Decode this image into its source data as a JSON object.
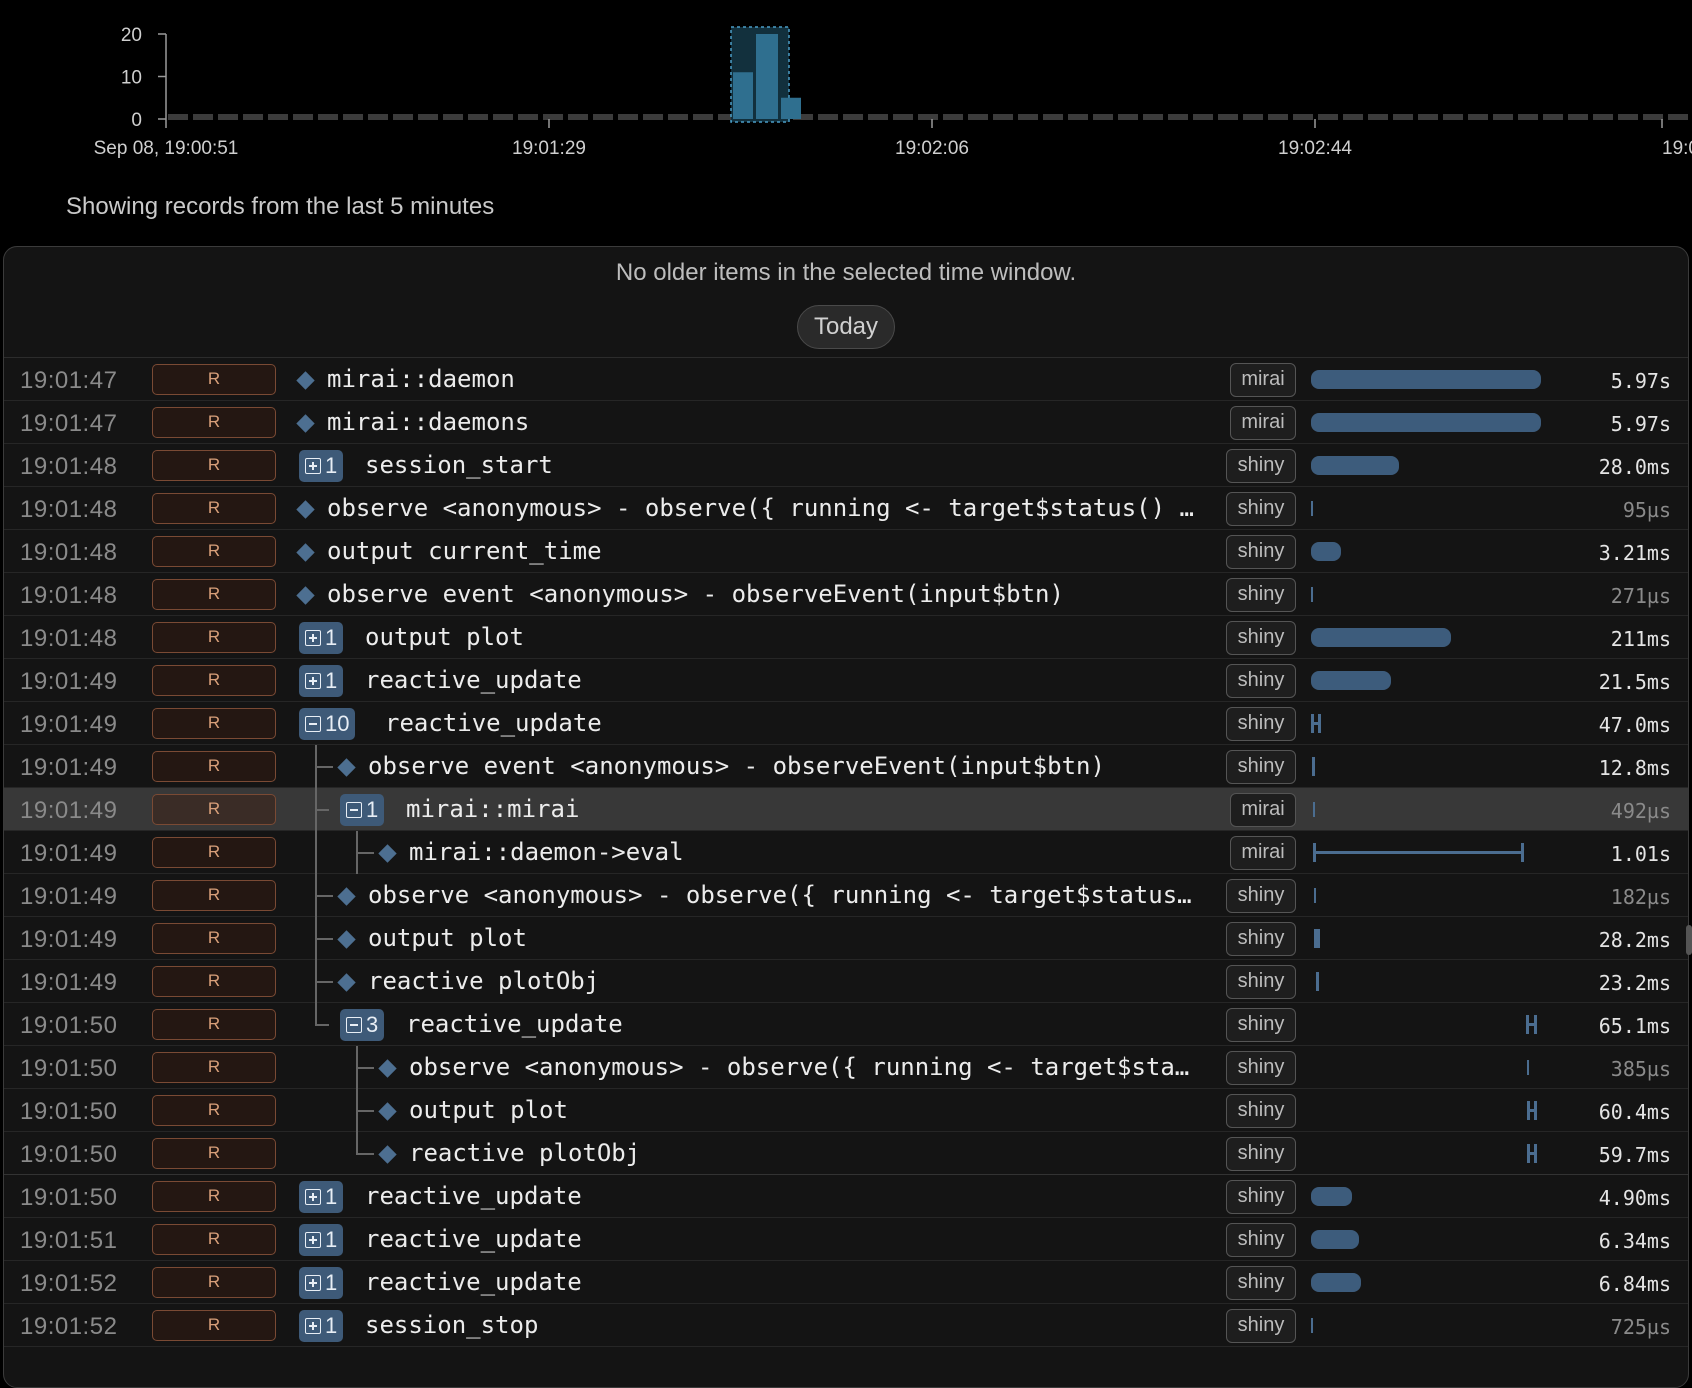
{
  "histogram": {
    "y_ticks": [
      "20",
      "10",
      "0"
    ],
    "x_ticks": [
      "Sep 08, 19:00:51",
      "19:01:29",
      "19:02:06",
      "19:02:44",
      "19:0"
    ],
    "colors": {
      "bar": "#2f6f8f",
      "selection": "#12303d",
      "baseline": "#3c3c3c"
    },
    "chart_data": {
      "type": "bar",
      "title": "",
      "xlabel": "",
      "ylabel": "",
      "ylim": [
        0,
        22
      ],
      "categories": [
        "19:01:47",
        "19:01:49",
        "19:01:51"
      ],
      "values": [
        11,
        20,
        5
      ]
    }
  },
  "status": {
    "showing_text": "Showing records from the last 5 minutes"
  },
  "header": {
    "no_older_text": "No older items in the selected time window.",
    "today_label": "Today"
  },
  "rows": [
    {
      "time": "19:01:47",
      "lang": "R",
      "kind": "leaf",
      "indent": 0,
      "name": "mirai::daemon",
      "lib": "mirai",
      "vis": "bar",
      "v_start": 0.0,
      "v_width": 0.92,
      "duration": "5.97s",
      "dim": false
    },
    {
      "time": "19:01:47",
      "lang": "R",
      "kind": "leaf",
      "indent": 0,
      "name": "mirai::daemons",
      "lib": "mirai",
      "vis": "bar",
      "v_start": 0.0,
      "v_width": 0.92,
      "duration": "5.97s",
      "dim": false
    },
    {
      "time": "19:01:48",
      "lang": "R",
      "kind": "group",
      "expanded": false,
      "count": "1",
      "indent": 0,
      "name": "session_start",
      "lib": "shiny",
      "vis": "bar",
      "v_start": 0.0,
      "v_width": 0.35,
      "duration": "28.0ms",
      "dim": false
    },
    {
      "time": "19:01:48",
      "lang": "R",
      "kind": "leaf",
      "indent": 0,
      "name": "observe <anonymous> - observe({ running <- target$status() …",
      "lib": "shiny",
      "vis": "tick",
      "v_start": 0.0,
      "duration": "95µs",
      "dim": true
    },
    {
      "time": "19:01:48",
      "lang": "R",
      "kind": "leaf",
      "indent": 0,
      "name": "output current_time",
      "lib": "shiny",
      "vis": "bar",
      "v_start": 0.0,
      "v_width": 0.12,
      "duration": "3.21ms",
      "dim": false
    },
    {
      "time": "19:01:48",
      "lang": "R",
      "kind": "leaf",
      "indent": 0,
      "name": "observe event <anonymous> - observeEvent(input$btn)",
      "lib": "shiny",
      "vis": "tick",
      "v_start": 0.0,
      "duration": "271µs",
      "dim": true
    },
    {
      "time": "19:01:48",
      "lang": "R",
      "kind": "group",
      "expanded": false,
      "count": "1",
      "indent": 0,
      "name": "output plot",
      "lib": "shiny",
      "vis": "bar",
      "v_start": 0.0,
      "v_width": 0.56,
      "duration": "211ms",
      "dim": false
    },
    {
      "time": "19:01:49",
      "lang": "R",
      "kind": "group",
      "expanded": false,
      "count": "1",
      "indent": 0,
      "name": "reactive_update",
      "lib": "shiny",
      "vis": "bar",
      "v_start": 0.0,
      "v_width": 0.32,
      "duration": "21.5ms",
      "dim": false
    },
    {
      "time": "19:01:49",
      "lang": "R",
      "kind": "group",
      "expanded": true,
      "count": "10",
      "indent": 0,
      "name": "reactive_update",
      "lib": "shiny",
      "vis": "span",
      "v_start": 0.0,
      "v_width": 0.04,
      "duration": "47.0ms",
      "dim": false
    },
    {
      "time": "19:01:49",
      "lang": "R",
      "kind": "leaf",
      "indent": 1,
      "name": "observe event <anonymous> - observeEvent(input$btn)",
      "lib": "shiny",
      "vis": "tick",
      "v_start": 0.004,
      "duration": "12.8ms",
      "dim": false
    },
    {
      "time": "19:01:49",
      "lang": "R",
      "kind": "group",
      "expanded": true,
      "count": "1",
      "indent": 1,
      "name": "mirai::mirai",
      "lib": "mirai",
      "vis": "tick",
      "v_start": 0.006,
      "duration": "492µs",
      "dim": true,
      "selected": true
    },
    {
      "time": "19:01:49",
      "lang": "R",
      "kind": "leaf",
      "indent": 2,
      "name": "mirai::daemon->eval",
      "lib": "mirai",
      "vis": "span",
      "v_start": 0.006,
      "v_width": 0.845,
      "duration": "1.01s",
      "dim": false
    },
    {
      "time": "19:01:49",
      "lang": "R",
      "kind": "leaf",
      "indent": 1,
      "name": "observe <anonymous> - observe({ running <- target$status…",
      "lib": "shiny",
      "vis": "tick",
      "v_start": 0.01,
      "duration": "182µs",
      "dim": true
    },
    {
      "time": "19:01:49",
      "lang": "R",
      "kind": "leaf",
      "indent": 1,
      "name": "output plot",
      "lib": "shiny",
      "vis": "span",
      "v_start": 0.01,
      "v_width": 0.02,
      "duration": "28.2ms",
      "dim": false
    },
    {
      "time": "19:01:49",
      "lang": "R",
      "kind": "leaf",
      "indent": 1,
      "name": "reactive plotObj",
      "lib": "shiny",
      "vis": "tick",
      "v_start": 0.02,
      "duration": "23.2ms",
      "dim": false
    },
    {
      "time": "19:01:50",
      "lang": "R",
      "kind": "group",
      "expanded": true,
      "count": "3",
      "indent": 1,
      "name": "reactive_update",
      "lib": "shiny",
      "vis": "span",
      "v_start": 0.86,
      "v_width": 0.045,
      "duration": "65.1ms",
      "dim": false,
      "last_child": true
    },
    {
      "time": "19:01:50",
      "lang": "R",
      "kind": "leaf",
      "indent": 2,
      "name": "observe <anonymous> - observe({ running <- target$sta…",
      "lib": "shiny",
      "vis": "tick",
      "v_start": 0.865,
      "duration": "385µs",
      "dim": true
    },
    {
      "time": "19:01:50",
      "lang": "R",
      "kind": "leaf",
      "indent": 2,
      "name": "output plot",
      "lib": "shiny",
      "vis": "span",
      "v_start": 0.865,
      "v_width": 0.04,
      "duration": "60.4ms",
      "dim": false
    },
    {
      "time": "19:01:50",
      "lang": "R",
      "kind": "leaf",
      "indent": 2,
      "name": "reactive plotObj",
      "lib": "shiny",
      "vis": "span",
      "v_start": 0.865,
      "v_width": 0.04,
      "duration": "59.7ms",
      "dim": false,
      "last_child": true,
      "gap_after": true
    },
    {
      "time": "19:01:50",
      "lang": "R",
      "kind": "group",
      "expanded": false,
      "count": "1",
      "indent": 0,
      "name": "reactive_update",
      "lib": "shiny",
      "vis": "bar",
      "v_start": 0.0,
      "v_width": 0.165,
      "duration": "4.90ms",
      "dim": false
    },
    {
      "time": "19:01:51",
      "lang": "R",
      "kind": "group",
      "expanded": false,
      "count": "1",
      "indent": 0,
      "name": "reactive_update",
      "lib": "shiny",
      "vis": "bar",
      "v_start": 0.0,
      "v_width": 0.19,
      "duration": "6.34ms",
      "dim": false
    },
    {
      "time": "19:01:52",
      "lang": "R",
      "kind": "group",
      "expanded": false,
      "count": "1",
      "indent": 0,
      "name": "reactive_update",
      "lib": "shiny",
      "vis": "bar",
      "v_start": 0.0,
      "v_width": 0.2,
      "duration": "6.84ms",
      "dim": false
    },
    {
      "time": "19:01:52",
      "lang": "R",
      "kind": "group",
      "expanded": false,
      "count": "1",
      "indent": 0,
      "name": "session_stop",
      "lib": "shiny",
      "vis": "tick",
      "v_start": 0.0,
      "duration": "725µs",
      "dim": true
    }
  ]
}
